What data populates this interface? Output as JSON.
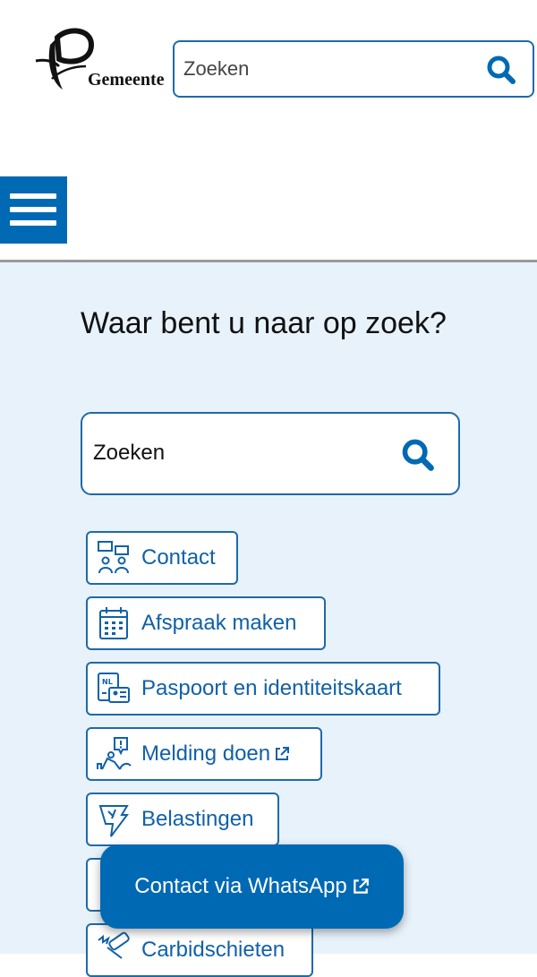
{
  "header": {
    "logo_text": "Gemeente",
    "search": {
      "placeholder": "Zoeken",
      "icon": "search-icon"
    },
    "menu_icon": "hamburger-menu-icon"
  },
  "main": {
    "heading": "Waar bent u naar op zoek?",
    "search": {
      "placeholder": "Zoeken",
      "icon": "search-icon"
    },
    "links": [
      {
        "label": "Contact",
        "icon": "contact-icon",
        "external": false
      },
      {
        "label": "Afspraak maken",
        "icon": "calendar-icon",
        "external": false
      },
      {
        "label": "Paspoort en identiteitskaart",
        "icon": "passport-id-icon",
        "external": false
      },
      {
        "label": "Melding doen",
        "icon": "report-icon",
        "external": true
      },
      {
        "label": "Belastingen",
        "icon": "taxes-icon",
        "external": false
      },
      {
        "label": "",
        "icon": "hidden-item-icon",
        "external": false
      },
      {
        "label": "Carbidschieten",
        "icon": "carbide-shooting-icon",
        "external": false
      }
    ]
  },
  "whatsapp": {
    "label": "Contact via WhatsApp",
    "external": true
  },
  "colors": {
    "primary": "#0069b4",
    "border": "#1f6aa8",
    "link_text": "#1061a8",
    "background": "#e8f2fb"
  }
}
